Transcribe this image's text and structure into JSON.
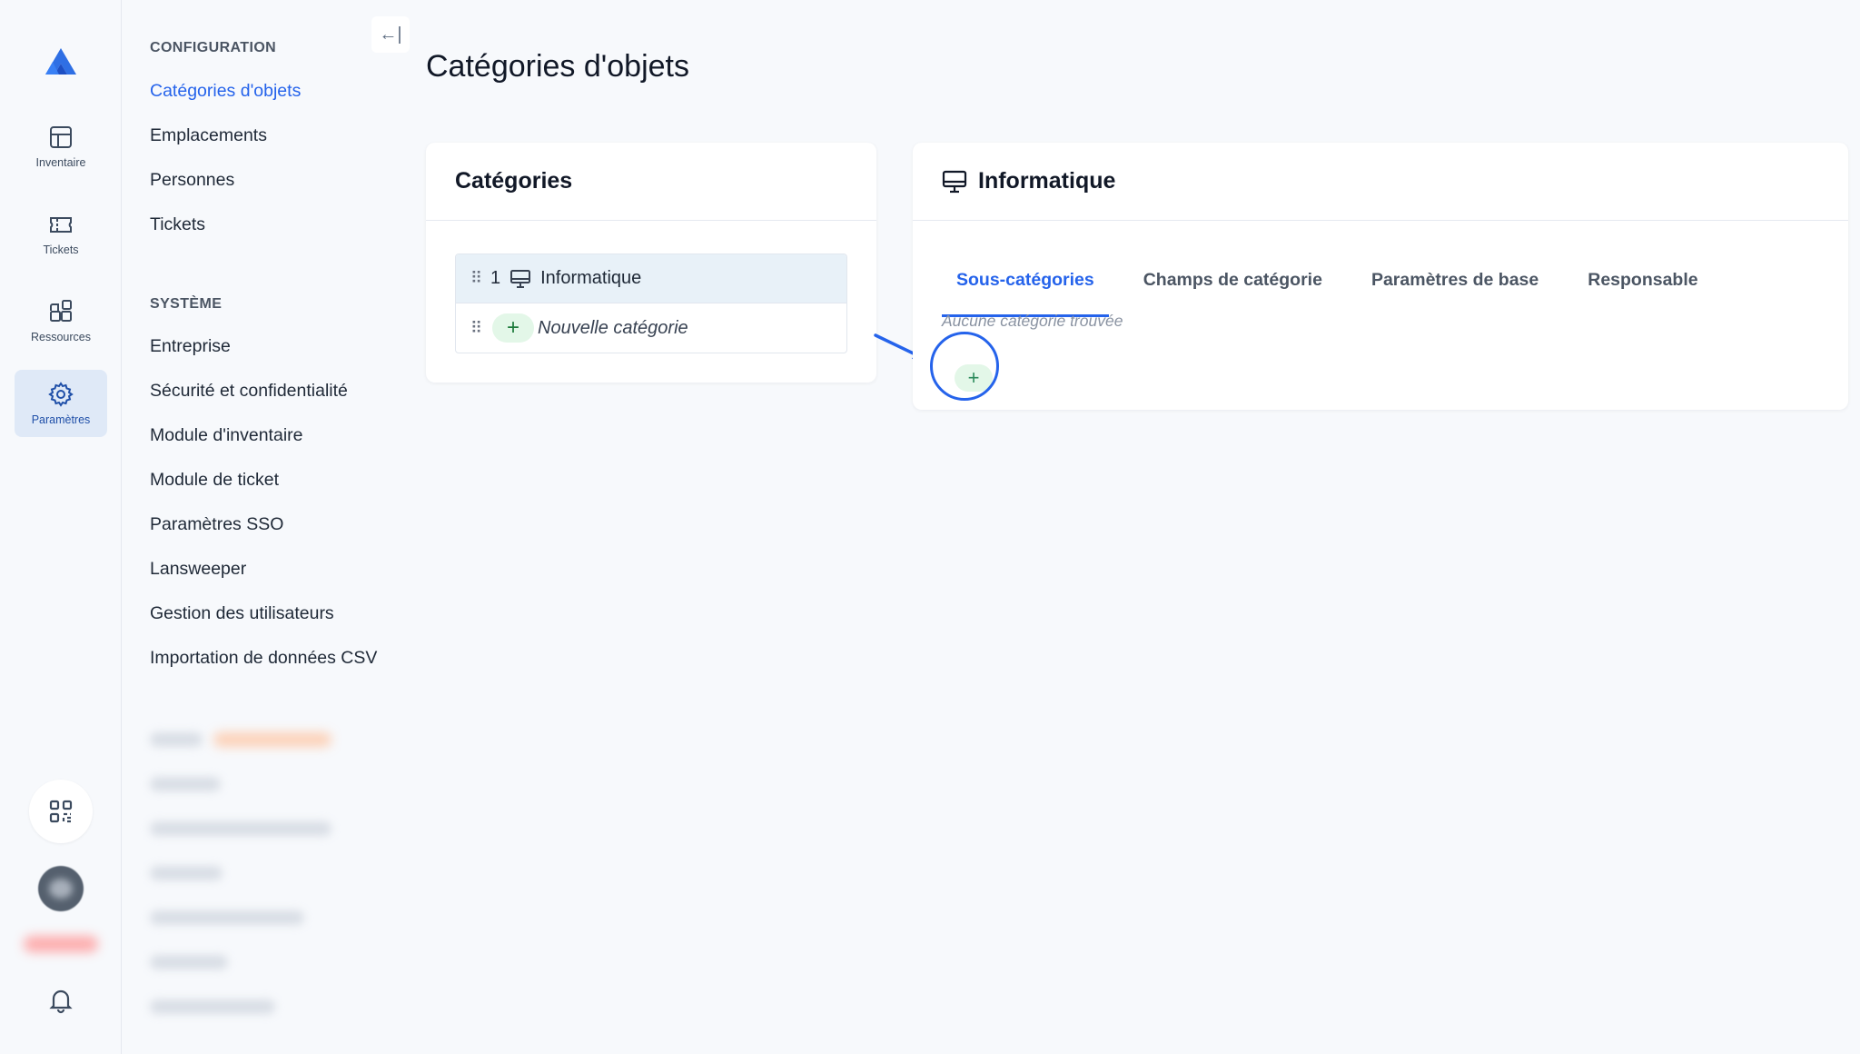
{
  "rail": {
    "items": [
      {
        "label": "Inventaire",
        "icon": "table-icon"
      },
      {
        "label": "Tickets",
        "icon": "ticket-icon"
      },
      {
        "label": "Ressources",
        "icon": "resources-icon"
      },
      {
        "label": "Paramètres",
        "icon": "gear-icon",
        "active": true
      }
    ]
  },
  "nav": {
    "collapse_icon": "←|",
    "config_title": "CONFIGURATION",
    "config_links": [
      "Catégories d'objets",
      "Emplacements",
      "Personnes",
      "Tickets"
    ],
    "system_title": "SYSTÈME",
    "system_links": [
      "Entreprise",
      "Sécurité et confidentialité",
      "Module d'inventaire",
      "Module de ticket",
      "Paramètres SSO",
      "Lansweeper",
      "Gestion des utilisateurs",
      "Importation de données CSV"
    ]
  },
  "main": {
    "title": "Catégories d'objets",
    "categories_card": {
      "title": "Catégories",
      "rows": [
        {
          "drag": "⠿",
          "number": "1",
          "icon": "monitor-icon",
          "label": "Informatique",
          "selected": true
        },
        {
          "drag": "⠿",
          "plus": "+",
          "label": "Nouvelle catégorie"
        }
      ]
    },
    "detail_card": {
      "title": "Informatique",
      "icon": "monitor-icon",
      "tabs": [
        "Sous-catégories",
        "Champs de catégorie",
        "Paramètres de base",
        "Responsable"
      ],
      "active_tab": "Sous-catégories",
      "empty_text": "Aucune catégorie trouvée",
      "add_label": "+"
    }
  },
  "colors": {
    "accent": "#2563eb",
    "active_rail_bg": "#dfe9f7",
    "add_pill_bg": "#e3f7e8"
  }
}
